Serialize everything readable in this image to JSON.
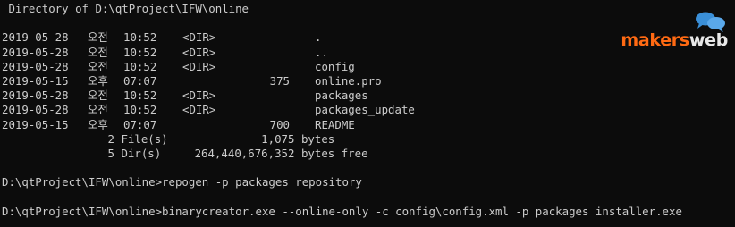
{
  "header": "Directory of D:\\qtProject\\IFW\\online",
  "entries": [
    {
      "date": "2019-05-28",
      "ampm": "오전",
      "time": "10:52",
      "dir": "<DIR>",
      "size": "",
      "name": "."
    },
    {
      "date": "2019-05-28",
      "ampm": "오전",
      "time": "10:52",
      "dir": "<DIR>",
      "size": "",
      "name": ".."
    },
    {
      "date": "2019-05-28",
      "ampm": "오전",
      "time": "10:52",
      "dir": "<DIR>",
      "size": "",
      "name": "config"
    },
    {
      "date": "2019-05-15",
      "ampm": "오후",
      "time": "07:07",
      "dir": "",
      "size": "375",
      "name": "online.pro"
    },
    {
      "date": "2019-05-28",
      "ampm": "오전",
      "time": "10:52",
      "dir": "<DIR>",
      "size": "",
      "name": "packages"
    },
    {
      "date": "2019-05-28",
      "ampm": "오전",
      "time": "10:52",
      "dir": "<DIR>",
      "size": "",
      "name": "packages_update"
    },
    {
      "date": "2019-05-15",
      "ampm": "오후",
      "time": "07:07",
      "dir": "",
      "size": "700",
      "name": "README"
    }
  ],
  "summary": {
    "files": {
      "count": "2",
      "label": "File(s)",
      "bytes": "1,075",
      "suffix": "bytes"
    },
    "dirs": {
      "count": "5",
      "label": "Dir(s)",
      "bytes": "264,440,676,352",
      "suffix": "bytes free"
    }
  },
  "commands": [
    {
      "prompt": "D:\\qtProject\\IFW\\online>",
      "command": "repogen -p packages repository"
    },
    {
      "prompt": "D:\\qtProject\\IFW\\online>",
      "command": "binarycreator.exe --online-only -c config\\config.xml -p packages installer.exe"
    }
  ],
  "logo": {
    "part1": "makers",
    "part2": "web",
    "color_primary": "#ff6a13",
    "color_secondary": "#e9e9e9",
    "icon": "speech-bubbles-icon"
  },
  "colors": {
    "background": "#0c0c0c",
    "text": "#cccccc"
  }
}
